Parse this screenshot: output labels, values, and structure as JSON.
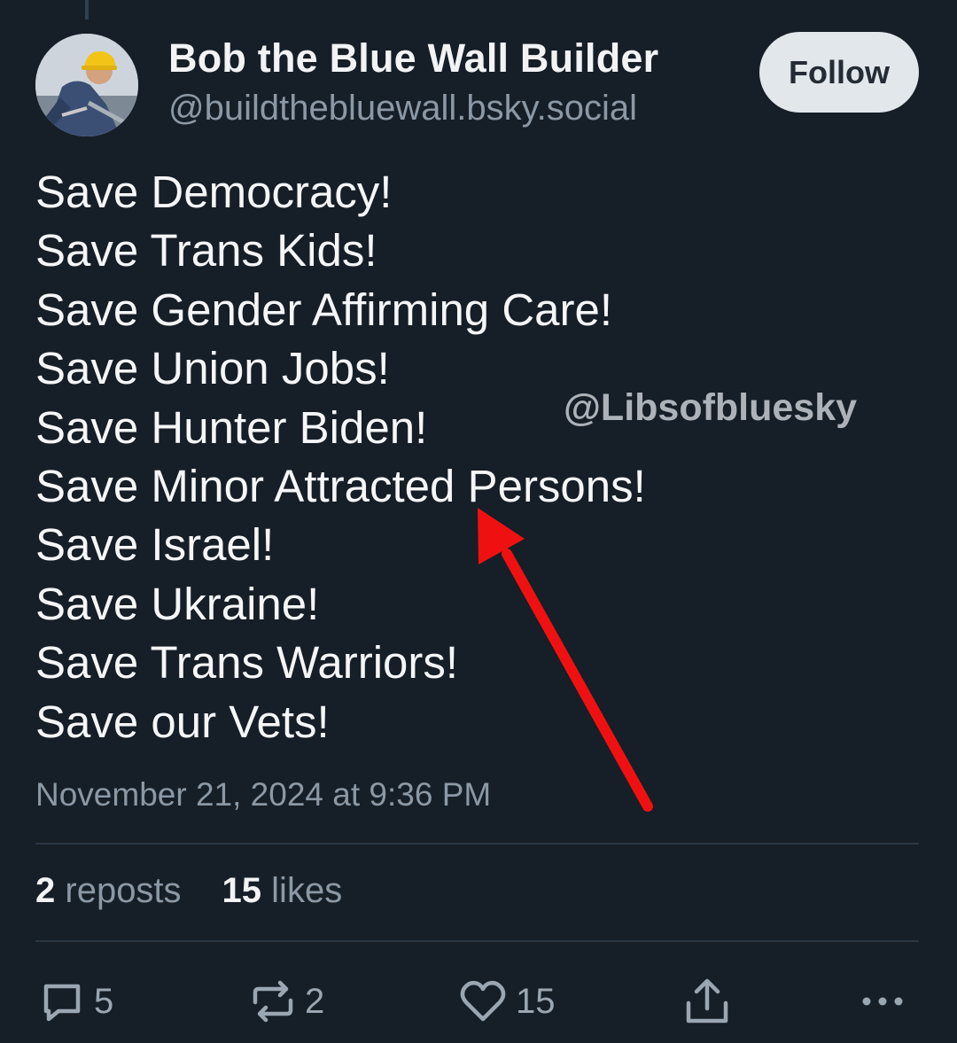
{
  "author": {
    "display_name": "Bob the Blue Wall Builder",
    "handle": "@buildthebluewall.bsky.social"
  },
  "follow_label": "Follow",
  "post_lines": [
    "Save Democracy!",
    "Save Trans Kids!",
    "Save Gender Affirming Care!",
    "Save Union Jobs!",
    "Save Hunter Biden!",
    "Save Minor Attracted Persons!",
    "Save Israel!",
    "Save Ukraine!",
    "Save Trans Warriors!",
    "Save our Vets!"
  ],
  "watermark": "@Libsofbluesky",
  "timestamp": "November 21, 2024 at 9:36 PM",
  "stats": {
    "reposts_count": "2",
    "reposts_label": "reposts",
    "likes_count": "15",
    "likes_label": "likes"
  },
  "actions": {
    "reply_count": "5",
    "repost_count": "2",
    "like_count": "15"
  },
  "icons": [
    "reply-icon",
    "repost-icon",
    "like-icon",
    "share-icon",
    "more-icon"
  ],
  "colors": {
    "background": "#161e27",
    "text": "#f1f3f5",
    "muted": "#8b98a5",
    "follow_button": "#e2e7ec",
    "arrow": "#ef1111"
  }
}
